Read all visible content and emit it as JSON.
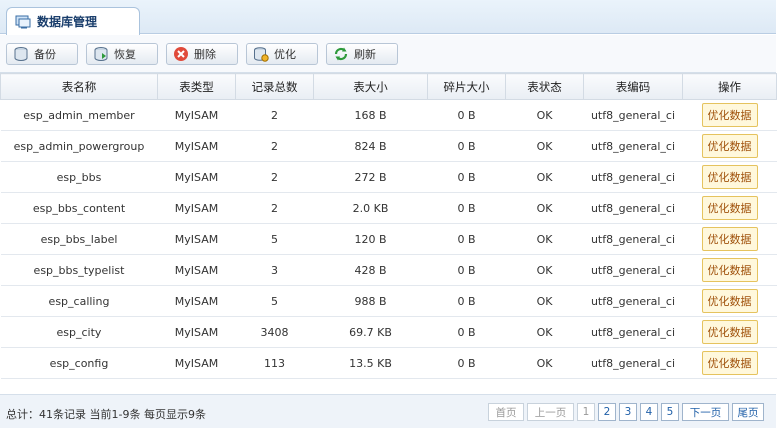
{
  "tab": {
    "title": "数据库管理"
  },
  "toolbar": [
    {
      "label": "备份",
      "icon": "backup-icon"
    },
    {
      "label": "恢复",
      "icon": "restore-icon"
    },
    {
      "label": "删除",
      "icon": "delete-icon"
    },
    {
      "label": "优化",
      "icon": "optimize-icon"
    },
    {
      "label": "刷新",
      "icon": "refresh-icon"
    }
  ],
  "table": {
    "columns": [
      "表名称",
      "表类型",
      "记录总数",
      "表大小",
      "碎片大小",
      "表状态",
      "表编码",
      "操作"
    ],
    "action_label": "优化数据",
    "rows": [
      [
        "esp_admin_member",
        "MyISAM",
        "2",
        "168 B",
        "0 B",
        "OK",
        "utf8_general_ci"
      ],
      [
        "esp_admin_powergroup",
        "MyISAM",
        "2",
        "824 B",
        "0 B",
        "OK",
        "utf8_general_ci"
      ],
      [
        "esp_bbs",
        "MyISAM",
        "2",
        "272 B",
        "0 B",
        "OK",
        "utf8_general_ci"
      ],
      [
        "esp_bbs_content",
        "MyISAM",
        "2",
        "2.0 KB",
        "0 B",
        "OK",
        "utf8_general_ci"
      ],
      [
        "esp_bbs_label",
        "MyISAM",
        "5",
        "120 B",
        "0 B",
        "OK",
        "utf8_general_ci"
      ],
      [
        "esp_bbs_typelist",
        "MyISAM",
        "3",
        "428 B",
        "0 B",
        "OK",
        "utf8_general_ci"
      ],
      [
        "esp_calling",
        "MyISAM",
        "5",
        "988 B",
        "0 B",
        "OK",
        "utf8_general_ci"
      ],
      [
        "esp_city",
        "MyISAM",
        "3408",
        "69.7 KB",
        "0 B",
        "OK",
        "utf8_general_ci"
      ],
      [
        "esp_config",
        "MyISAM",
        "113",
        "13.5 KB",
        "0 B",
        "OK",
        "utf8_general_ci"
      ]
    ]
  },
  "footer": {
    "summary": "总计：41条记录 当前1-9条 每页显示9条",
    "first": "首页",
    "prev": "上一页",
    "pages": [
      "1",
      "2",
      "3",
      "4",
      "5"
    ],
    "current_page": "1",
    "next": "下一页",
    "last": "尾页"
  }
}
